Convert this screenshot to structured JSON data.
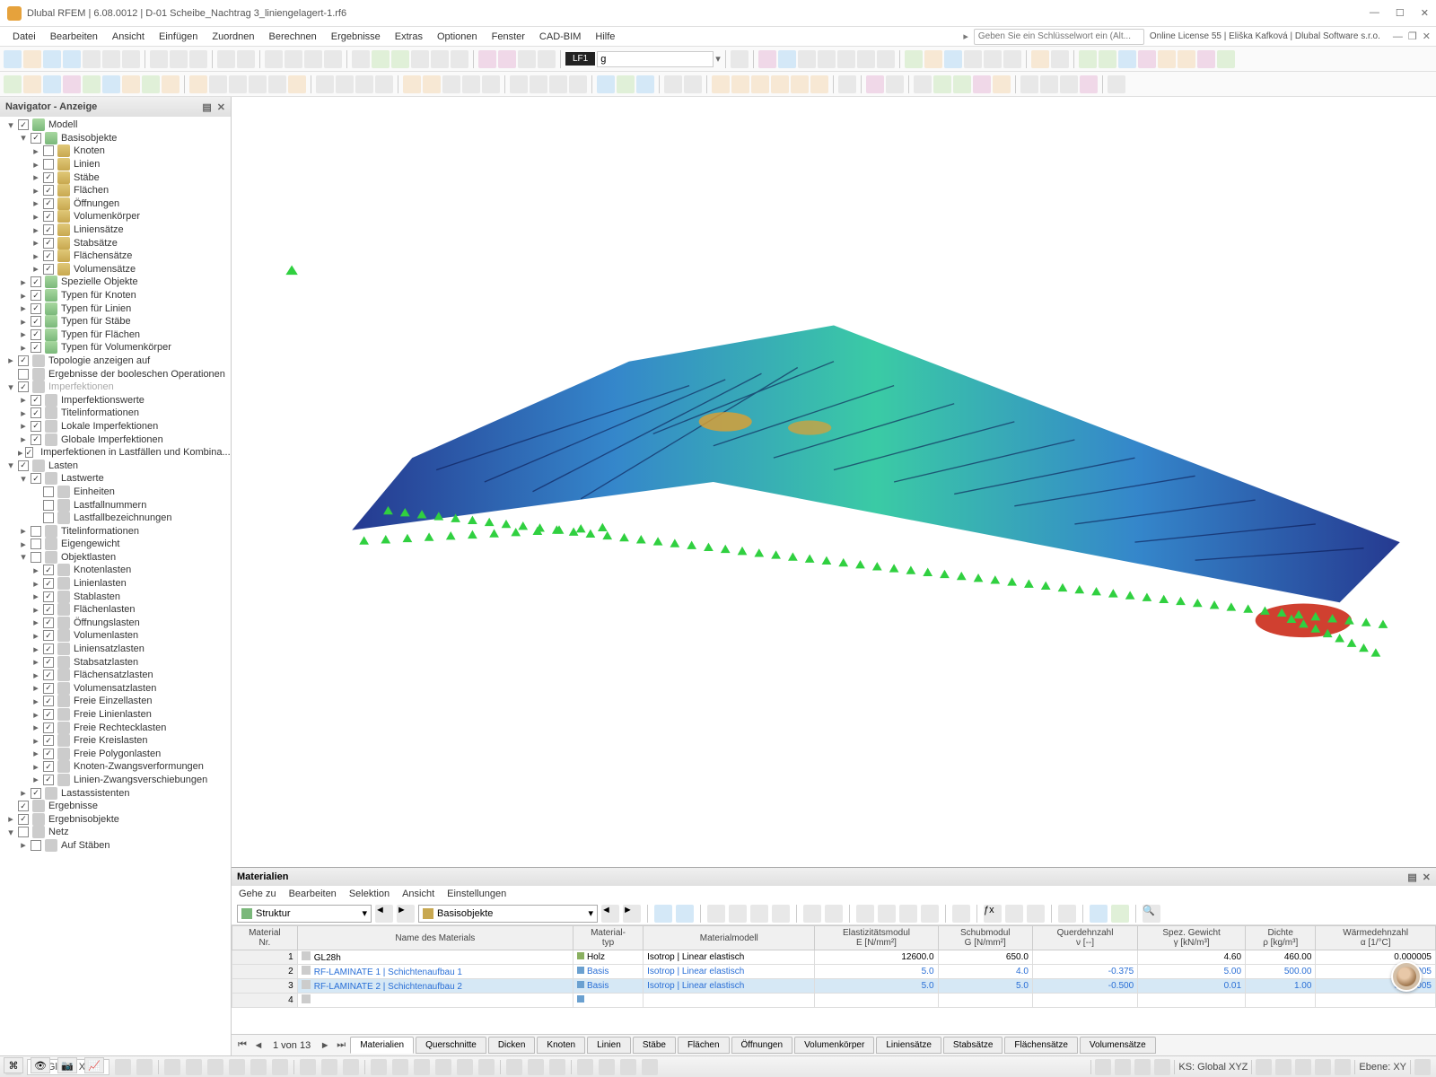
{
  "title": "Dlubal RFEM | 6.08.0012 | D-01 Scheibe_Nachtrag 3_liniengelagert-1.rf6",
  "license": "Online License 55 | Eliška Kafková | Dlubal Software s.r.o.",
  "search_placeholder": "Geben Sie ein Schlüsselwort ein (Alt...",
  "menu": [
    "Datei",
    "Bearbeiten",
    "Ansicht",
    "Einfügen",
    "Zuordnen",
    "Berechnen",
    "Ergebnisse",
    "Extras",
    "Optionen",
    "Fenster",
    "CAD-BIM",
    "Hilfe"
  ],
  "lf_label": "LF1",
  "lf_input": "g",
  "nav_title": "Navigator - Anzeige",
  "tree": [
    {
      "d": 0,
      "e": "▾",
      "c": true,
      "i": "model",
      "t": "Modell"
    },
    {
      "d": 1,
      "e": "▾",
      "c": true,
      "i": "model",
      "t": "Basisobjekte"
    },
    {
      "d": 2,
      "e": "▸",
      "c": false,
      "i": "obj",
      "t": "Knoten"
    },
    {
      "d": 2,
      "e": "▸",
      "c": false,
      "i": "obj",
      "t": "Linien"
    },
    {
      "d": 2,
      "e": "▸",
      "c": true,
      "i": "obj",
      "t": "Stäbe"
    },
    {
      "d": 2,
      "e": "▸",
      "c": true,
      "i": "obj",
      "t": "Flächen"
    },
    {
      "d": 2,
      "e": "▸",
      "c": true,
      "i": "obj",
      "t": "Öffnungen"
    },
    {
      "d": 2,
      "e": "▸",
      "c": true,
      "i": "obj",
      "t": "Volumenkörper"
    },
    {
      "d": 2,
      "e": "▸",
      "c": true,
      "i": "obj",
      "t": "Liniensätze"
    },
    {
      "d": 2,
      "e": "▸",
      "c": true,
      "i": "obj",
      "t": "Stabsätze"
    },
    {
      "d": 2,
      "e": "▸",
      "c": true,
      "i": "obj",
      "t": "Flächensätze"
    },
    {
      "d": 2,
      "e": "▸",
      "c": true,
      "i": "obj",
      "t": "Volumensätze"
    },
    {
      "d": 1,
      "e": "▸",
      "c": true,
      "i": "model",
      "t": "Spezielle Objekte"
    },
    {
      "d": 1,
      "e": "▸",
      "c": true,
      "i": "model",
      "t": "Typen für Knoten"
    },
    {
      "d": 1,
      "e": "▸",
      "c": true,
      "i": "model",
      "t": "Typen für Linien"
    },
    {
      "d": 1,
      "e": "▸",
      "c": true,
      "i": "model",
      "t": "Typen für Stäbe"
    },
    {
      "d": 1,
      "e": "▸",
      "c": true,
      "i": "model",
      "t": "Typen für Flächen"
    },
    {
      "d": 1,
      "e": "▸",
      "c": true,
      "i": "model",
      "t": "Typen für Volumenkörper"
    },
    {
      "d": 0,
      "e": "▸",
      "c": true,
      "i": "grey",
      "t": "Topologie anzeigen auf"
    },
    {
      "d": 0,
      "e": "",
      "c": false,
      "i": "grey",
      "t": "Ergebnisse der booleschen Operationen"
    },
    {
      "d": 0,
      "e": "▾",
      "c": true,
      "i": "grey",
      "t": "Imperfektionen",
      "dim": true
    },
    {
      "d": 1,
      "e": "▸",
      "c": true,
      "i": "grey",
      "t": "Imperfektionswerte"
    },
    {
      "d": 1,
      "e": "▸",
      "c": true,
      "i": "grey",
      "t": "Titelinformationen"
    },
    {
      "d": 1,
      "e": "▸",
      "c": true,
      "i": "grey",
      "t": "Lokale Imperfektionen"
    },
    {
      "d": 1,
      "e": "▸",
      "c": true,
      "i": "grey",
      "t": "Globale Imperfektionen"
    },
    {
      "d": 1,
      "e": "▸",
      "c": true,
      "i": "grey",
      "t": "Imperfektionen in Lastfällen und Kombina..."
    },
    {
      "d": 0,
      "e": "▾",
      "c": true,
      "i": "grey",
      "t": "Lasten"
    },
    {
      "d": 1,
      "e": "▾",
      "c": true,
      "i": "grey",
      "t": "Lastwerte"
    },
    {
      "d": 2,
      "e": "",
      "c": false,
      "i": "grey",
      "t": "Einheiten"
    },
    {
      "d": 2,
      "e": "",
      "c": false,
      "i": "grey",
      "t": "Lastfallnummern"
    },
    {
      "d": 2,
      "e": "",
      "c": false,
      "i": "grey",
      "t": "Lastfallbezeichnungen"
    },
    {
      "d": 1,
      "e": "▸",
      "c": false,
      "i": "grey",
      "t": "Titelinformationen"
    },
    {
      "d": 1,
      "e": "▸",
      "c": false,
      "i": "grey",
      "t": "Eigengewicht"
    },
    {
      "d": 1,
      "e": "▾",
      "c": false,
      "i": "grey",
      "t": "Objektlasten"
    },
    {
      "d": 2,
      "e": "▸",
      "c": true,
      "i": "grey",
      "t": "Knotenlasten"
    },
    {
      "d": 2,
      "e": "▸",
      "c": true,
      "i": "grey",
      "t": "Linienlasten"
    },
    {
      "d": 2,
      "e": "▸",
      "c": true,
      "i": "grey",
      "t": "Stablasten"
    },
    {
      "d": 2,
      "e": "▸",
      "c": true,
      "i": "grey",
      "t": "Flächenlasten"
    },
    {
      "d": 2,
      "e": "▸",
      "c": true,
      "i": "grey",
      "t": "Öffnungslasten"
    },
    {
      "d": 2,
      "e": "▸",
      "c": true,
      "i": "grey",
      "t": "Volumenlasten"
    },
    {
      "d": 2,
      "e": "▸",
      "c": true,
      "i": "grey",
      "t": "Liniensatzlasten"
    },
    {
      "d": 2,
      "e": "▸",
      "c": true,
      "i": "grey",
      "t": "Stabsatzlasten"
    },
    {
      "d": 2,
      "e": "▸",
      "c": true,
      "i": "grey",
      "t": "Flächensatzlasten"
    },
    {
      "d": 2,
      "e": "▸",
      "c": true,
      "i": "grey",
      "t": "Volumensatzlasten"
    },
    {
      "d": 2,
      "e": "▸",
      "c": true,
      "i": "grey",
      "t": "Freie Einzellasten"
    },
    {
      "d": 2,
      "e": "▸",
      "c": true,
      "i": "grey",
      "t": "Freie Linienlasten"
    },
    {
      "d": 2,
      "e": "▸",
      "c": true,
      "i": "grey",
      "t": "Freie Rechtecklasten"
    },
    {
      "d": 2,
      "e": "▸",
      "c": true,
      "i": "grey",
      "t": "Freie Kreislasten"
    },
    {
      "d": 2,
      "e": "▸",
      "c": true,
      "i": "grey",
      "t": "Freie Polygonlasten"
    },
    {
      "d": 2,
      "e": "▸",
      "c": true,
      "i": "grey",
      "t": "Knoten-Zwangsverformungen"
    },
    {
      "d": 2,
      "e": "▸",
      "c": true,
      "i": "grey",
      "t": "Linien-Zwangsverschiebungen"
    },
    {
      "d": 1,
      "e": "▸",
      "c": true,
      "i": "grey",
      "t": "Lastassistenten"
    },
    {
      "d": 0,
      "e": "",
      "c": true,
      "i": "grey",
      "t": "Ergebnisse"
    },
    {
      "d": 0,
      "e": "▸",
      "c": true,
      "i": "grey",
      "t": "Ergebnisobjekte"
    },
    {
      "d": 0,
      "e": "▾",
      "c": false,
      "i": "grey",
      "t": "Netz"
    },
    {
      "d": 1,
      "e": "▸",
      "c": false,
      "i": "grey",
      "t": "Auf Stäben"
    }
  ],
  "materials_title": "Materialien",
  "bp_menu": [
    "Gehe zu",
    "Bearbeiten",
    "Selektion",
    "Ansicht",
    "Einstellungen"
  ],
  "bp_sel1": "Struktur",
  "bp_sel2": "Basisobjekte",
  "table": {
    "headers": [
      "Material\nNr.",
      "Name des Materials",
      "Material-\ntyp",
      "Materialmodell",
      "Elastizitätsmodul\nE [N/mm²]",
      "Schubmodul\nG [N/mm²]",
      "Querdehnzahl\nν [--]",
      "Spez. Gewicht\nγ [kN/m³]",
      "Dichte\nρ [kg/m³]",
      "Wärmedehnzahl\nα [1/°C]"
    ],
    "rows": [
      {
        "nr": "1",
        "name": "GL28h",
        "typ": "Holz",
        "model": "Isotrop | Linear elastisch",
        "e": "12600.0",
        "g": "650.0",
        "v": "",
        "y": "4.60",
        "p": "460.00",
        "a": "0.000005",
        "link": false
      },
      {
        "nr": "2",
        "name": "RF-LAMINATE 1 | Schichtenaufbau 1",
        "typ": "Basis",
        "model": "Isotrop | Linear elastisch",
        "e": "5.0",
        "g": "4.0",
        "v": "-0.375",
        "y": "5.00",
        "p": "500.00",
        "a": "0.000005",
        "link": true
      },
      {
        "nr": "3",
        "name": "RF-LAMINATE 2 | Schichtenaufbau 2",
        "typ": "Basis",
        "model": "Isotrop | Linear elastisch",
        "e": "5.0",
        "g": "5.0",
        "v": "-0.500",
        "y": "0.01",
        "p": "1.00",
        "a": "0.000005",
        "link": true,
        "sel": true
      },
      {
        "nr": "4",
        "name": "",
        "typ": "",
        "model": "",
        "e": "",
        "g": "",
        "v": "",
        "y": "",
        "p": "",
        "a": ""
      }
    ]
  },
  "bp_page": "1 von 13",
  "bp_tabs": [
    "Materialien",
    "Querschnitte",
    "Dicken",
    "Knoten",
    "Linien",
    "Stäbe",
    "Flächen",
    "Öffnungen",
    "Volumenkörper",
    "Liniensätze",
    "Stabsätze",
    "Flächensätze",
    "Volumensätze"
  ],
  "status_coord": "1 - Global XYZ",
  "status_ks": "KS: Global XYZ",
  "status_ebene": "Ebene: XY"
}
